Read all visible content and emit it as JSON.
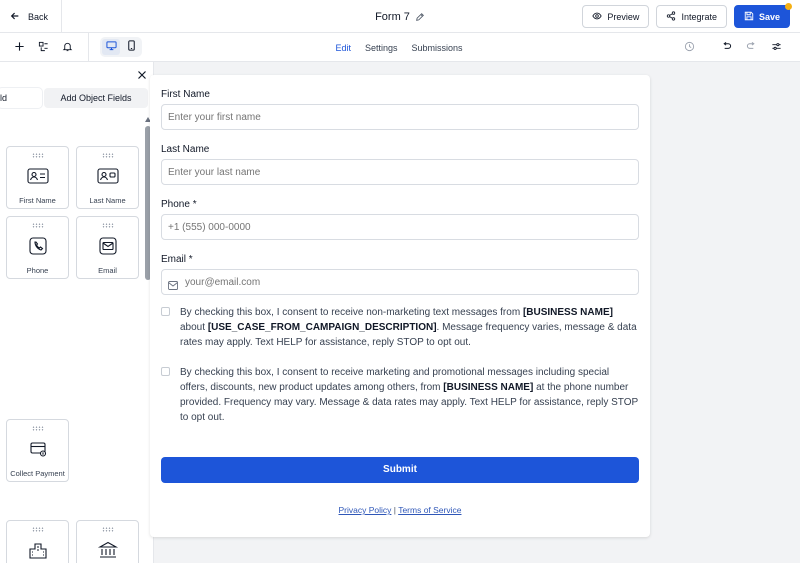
{
  "topbar": {
    "back_label": "Back",
    "form_title": "Form 7",
    "preview_label": "Preview",
    "integrate_label": "Integrate",
    "save_label": "Save"
  },
  "toolbar": {
    "tabs": [
      {
        "label": "Edit",
        "active": true
      },
      {
        "label": "Settings",
        "active": false
      },
      {
        "label": "Submissions",
        "active": false
      }
    ],
    "device_active": "desktop"
  },
  "left_panel": {
    "tab_partial": "ld",
    "tab_object": "Add Object Fields",
    "fields": [
      {
        "label": "First Name",
        "icon": "id-card-icon"
      },
      {
        "label": "Last Name",
        "icon": "id-card-icon"
      },
      {
        "label": "Phone",
        "icon": "phone-icon"
      },
      {
        "label": "Email",
        "icon": "envelope-icon"
      },
      {
        "label": "Collect Payment",
        "icon": "payment-card-icon"
      }
    ]
  },
  "form": {
    "first_name": {
      "label": "First Name",
      "placeholder": "Enter your first name"
    },
    "last_name": {
      "label": "Last Name",
      "placeholder": "Enter your last name"
    },
    "phone": {
      "label": "Phone *",
      "placeholder": "+1 (555) 000-0000"
    },
    "email": {
      "label": "Email *",
      "placeholder": "your@email.com"
    },
    "consent_1": {
      "p1": "By checking this box, I consent to receive non-marketing text messages from ",
      "b1": "[BUSINESS NAME]",
      "p2": " about ",
      "b2": "[USE_CASE_FROM_CAMPAIGN_DESCRIPTION]",
      "p3": ". Message frequency varies, message & data rates may apply. Text HELP for assistance, reply STOP to opt out."
    },
    "consent_2": {
      "p1": "By checking this box, I consent to receive marketing and promotional messages including special offers, discounts, new product updates among others, from ",
      "b1": "[BUSINESS NAME]",
      "p2": " at the phone number provided. Frequency may vary. Message & data rates may apply. Text HELP for assistance, reply STOP to opt out."
    },
    "submit_label": "Submit",
    "privacy_label": "Privacy Policy",
    "separator": " | ",
    "terms_label": "Terms of Service"
  },
  "colors": {
    "accent": "#1d55d9",
    "badge": "#f5b014"
  }
}
